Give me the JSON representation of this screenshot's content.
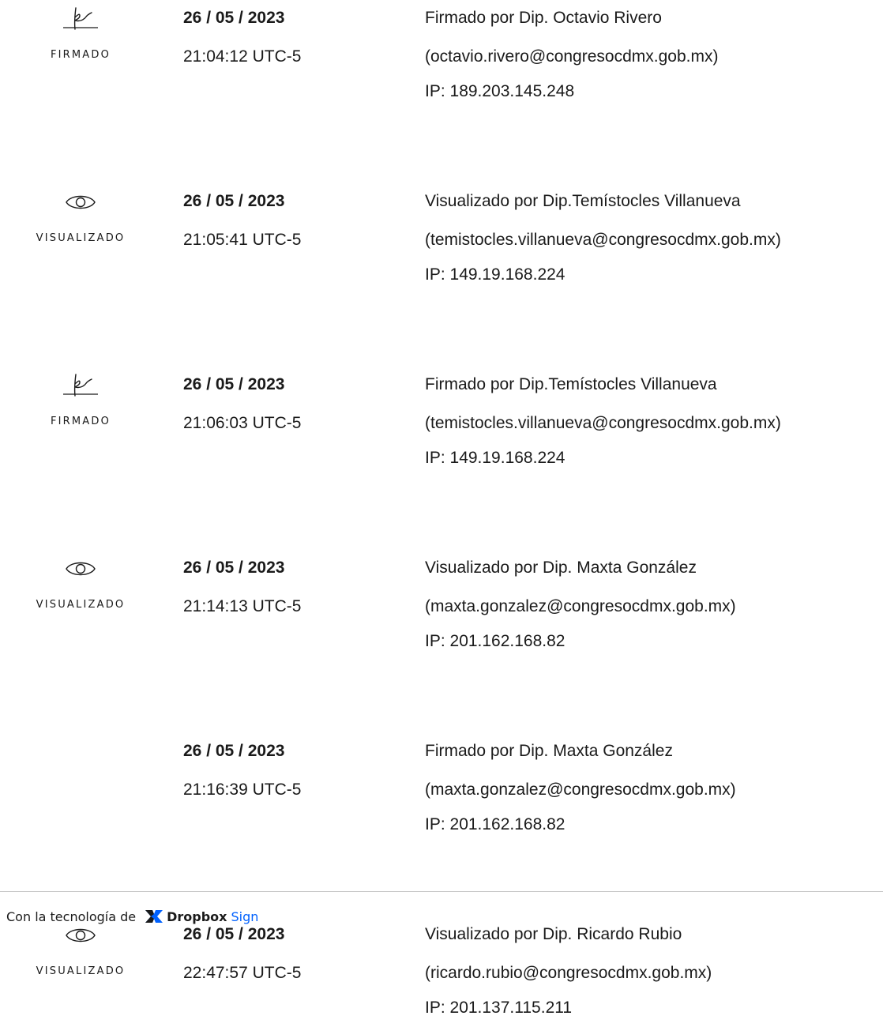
{
  "entries": [
    {
      "icon": "signature-icon",
      "action_label": "FIRMADO",
      "date": "26 / 05 / 2023",
      "time": "21:04:12 UTC-5",
      "line1": "Firmado por Dip. Octavio Rivero",
      "line2": "(octavio.rivero@congresocdmx.gob.mx)",
      "line3": "IP: 189.203.145.248"
    },
    {
      "icon": "eye-icon",
      "action_label": "VISUALIZADO",
      "date": "26 / 05 / 2023",
      "time": "21:05:41 UTC-5",
      "line1": "Visualizado por Dip.Temístocles Villanueva",
      "line2": "(temistocles.villanueva@congresocdmx.gob.mx)",
      "line3": "IP: 149.19.168.224"
    },
    {
      "icon": "signature-icon",
      "action_label": "FIRMADO",
      "date": "26 / 05 / 2023",
      "time": "21:06:03 UTC-5",
      "line1": "Firmado por Dip.Temístocles Villanueva",
      "line2": "(temistocles.villanueva@congresocdmx.gob.mx)",
      "line3": "IP: 149.19.168.224"
    },
    {
      "icon": "eye-icon",
      "action_label": "VISUALIZADO",
      "date": "26 / 05 / 2023",
      "time": "21:14:13 UTC-5",
      "line1": "Visualizado por Dip. Maxta González",
      "line2": "(maxta.gonzalez@congresocdmx.gob.mx)",
      "line3": "IP: 201.162.168.82"
    },
    {
      "icon": "",
      "action_label": "",
      "date": "26 / 05 / 2023",
      "time": "21:16:39 UTC-5",
      "line1": "Firmado por Dip. Maxta González",
      "line2": "(maxta.gonzalez@congresocdmx.gob.mx)",
      "line3": "IP: 201.162.168.82"
    },
    {
      "icon": "eye-icon",
      "action_label": "VISUALIZADO",
      "date": "26 / 05 / 2023",
      "time": "22:47:57 UTC-5",
      "line1": "Visualizado por Dip. Ricardo Rubio",
      "line2": "(ricardo.rubio@congresocdmx.gob.mx)",
      "line3": "IP: 201.137.115.211"
    }
  ],
  "footer": {
    "powered_by": "Con la tecnología de",
    "brand_name": "Dropbox",
    "brand_product": "Sign",
    "brand_icon": "dropbox-logo-icon",
    "brand_color": "#0061fe"
  }
}
